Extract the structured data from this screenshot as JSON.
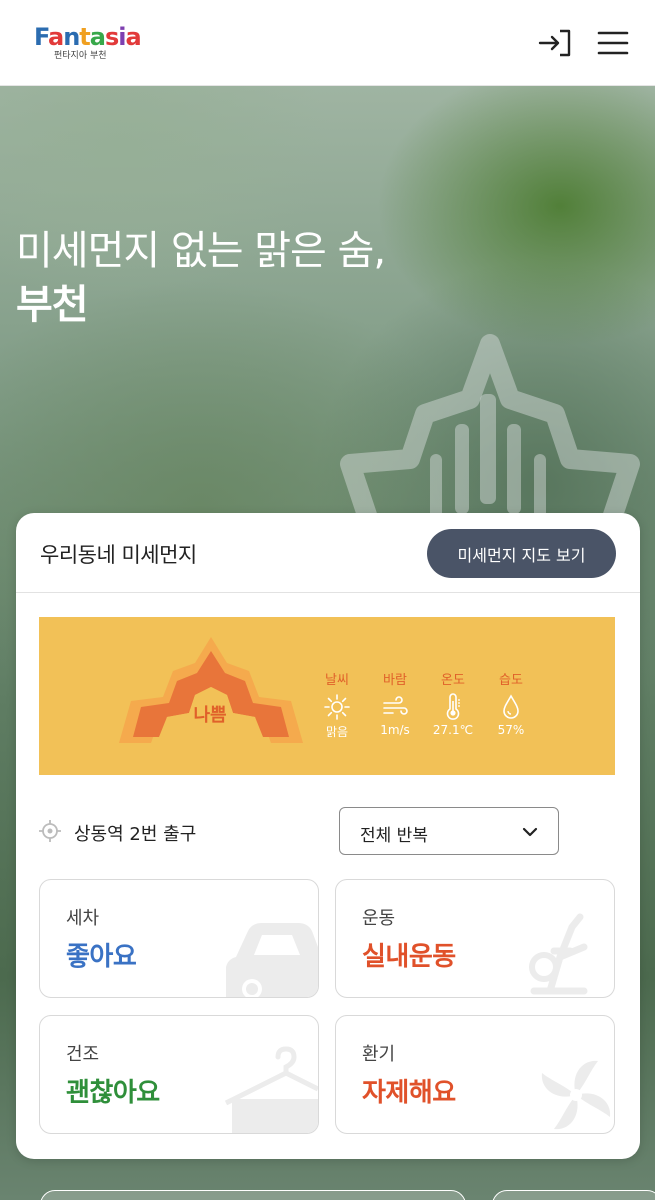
{
  "header": {
    "logo_text": "Fantasia",
    "logo_sub": "펀타지아 부천",
    "icons": [
      "login-icon",
      "menu-icon"
    ]
  },
  "hero": {
    "line1": "미세먼지 없는 맑은 숨,",
    "line2": "부천"
  },
  "card": {
    "title": "우리동네 미세먼지",
    "map_button": "미세먼지 지도 보기",
    "status": {
      "grade": "나쁨",
      "grade_color": "#e0612a",
      "panel_color": "#f2c157"
    },
    "weather": [
      {
        "label": "날씨",
        "icon": "sun-icon",
        "value": "맑음"
      },
      {
        "label": "바람",
        "icon": "wind-icon",
        "value": "1m/s"
      },
      {
        "label": "온도",
        "icon": "thermometer-icon",
        "value": "27.1℃"
      },
      {
        "label": "습도",
        "icon": "humidity-icon",
        "value": "57%"
      }
    ],
    "location": "상동역 2번 출구",
    "select_value": "전체 반복",
    "tiles": [
      {
        "label": "세차",
        "value": "좋아요",
        "color": "#3a72c4",
        "icon": "car-icon"
      },
      {
        "label": "운동",
        "value": "실내운동",
        "color": "#e0512a",
        "icon": "exercise-bike-icon"
      },
      {
        "label": "건조",
        "value": "괜찮아요",
        "color": "#2f8f3a",
        "icon": "hanger-icon"
      },
      {
        "label": "환기",
        "value": "자제해요",
        "color": "#e0512a",
        "icon": "fan-icon"
      }
    ]
  }
}
